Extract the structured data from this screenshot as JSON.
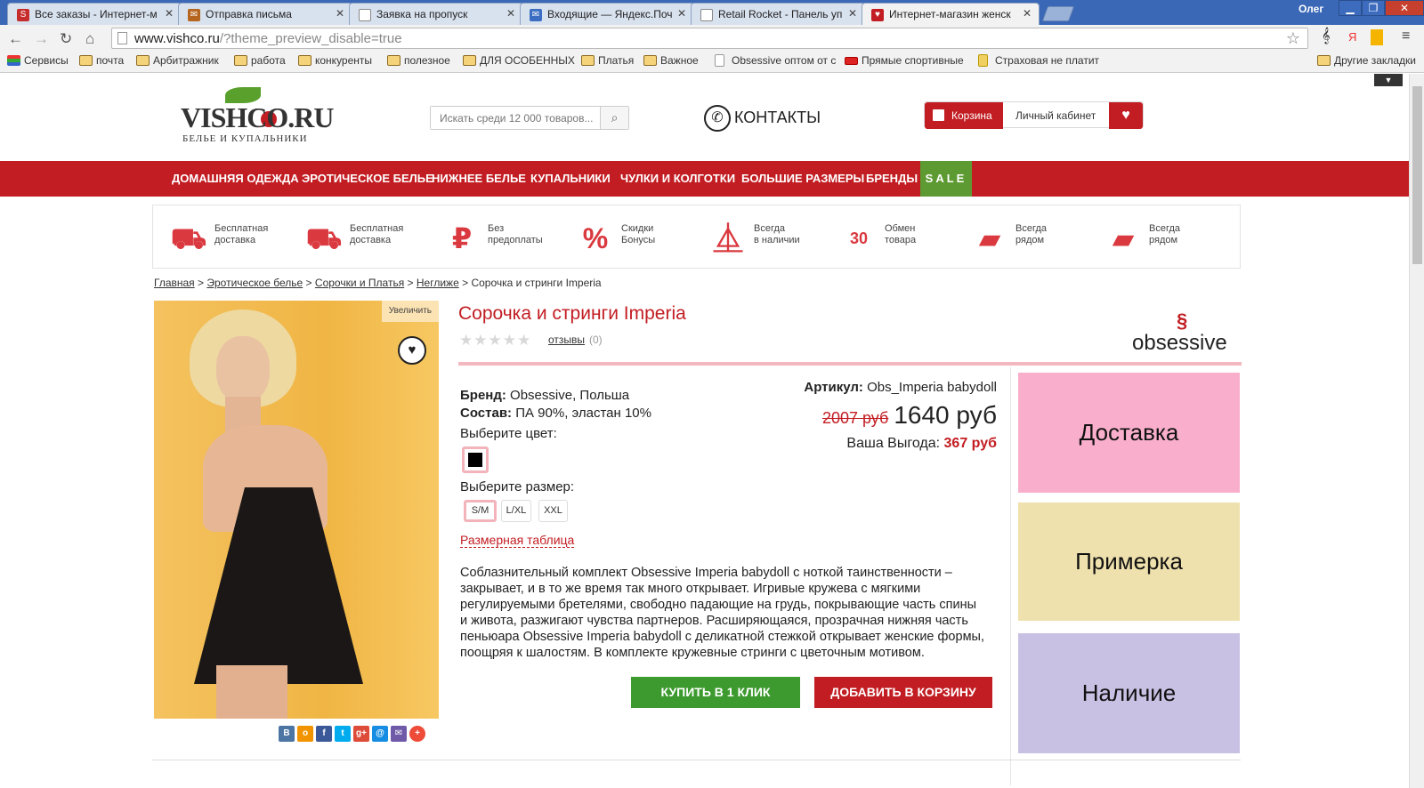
{
  "browser": {
    "tabs": [
      {
        "title": "Все заказы - Интернет-м",
        "fav_color": "#c72c2c",
        "fav_glyph": "S"
      },
      {
        "title": "Отправка письма",
        "fav_color": "#b5651d",
        "fav_glyph": "✉"
      },
      {
        "title": "Заявка на пропуск",
        "fav_color": "#ffffff",
        "fav_glyph": ""
      },
      {
        "title": "Входящие — Яндекс.Поч",
        "fav_color": "#3b6ec2",
        "fav_glyph": "✉"
      },
      {
        "title": "Retail Rocket - Панель уп",
        "fav_color": "#ffffff",
        "fav_glyph": ""
      },
      {
        "title": "Интернет-магазин женск",
        "fav_color": "#c21d22",
        "fav_glyph": "♥"
      }
    ],
    "user": "Олег",
    "url_host": "www.vishco.ru",
    "url_path": "/?theme_preview_disable=true",
    "bookmarks": [
      {
        "label": "Сервисы",
        "icon": "apps-icon"
      },
      {
        "label": "почта",
        "icon": "folder-icon"
      },
      {
        "label": "Арбитражник",
        "icon": "folder-icon"
      },
      {
        "label": "работа",
        "icon": "folder-icon"
      },
      {
        "label": "конкуренты",
        "icon": "folder-icon"
      },
      {
        "label": "полезное",
        "icon": "folder-icon"
      },
      {
        "label": "ДЛЯ ОСОБЕННЫХ",
        "icon": "folder-icon"
      },
      {
        "label": "Платья",
        "icon": "folder-icon"
      },
      {
        "label": "Важное",
        "icon": "folder-icon"
      },
      {
        "label": "Obsessive оптом от с",
        "icon": "page-icon"
      },
      {
        "label": "Прямые спортивные",
        "icon": "live-icon"
      },
      {
        "label": "Страховая не платит",
        "icon": "page-icon"
      },
      {
        "label": "Другие закладки",
        "icon": "folder-icon"
      }
    ]
  },
  "site": {
    "logo_text": "VISHCO.RU",
    "logo_sub": "БЕЛЬЕ И КУПАЛЬНИКИ",
    "search_placeholder": "Искать среди 12 000 товаров...",
    "contacts": "КОНТАКТЫ",
    "cart": "Корзина",
    "account": "Личный кабинет",
    "menu": [
      "ДОМАШНЯЯ ОДЕЖДА",
      "ЭРОТИЧЕСКОЕ БЕЛЬЕ",
      "НИЖНЕЕ БЕЛЬЕ",
      "КУПАЛЬНИКИ",
      "ЧУЛКИ И КОЛГОТКИ",
      "БОЛЬШИЕ РАЗМЕРЫ",
      "БРЕНДЫ",
      "SALE"
    ],
    "advantages": [
      {
        "icon": "truck-icon",
        "text": "Бесплатная\nдоставка"
      },
      {
        "icon": "truck-icon",
        "text": "Бесплатная\nдоставка"
      },
      {
        "icon": "money-bag-icon",
        "text": "Без\nпредоплаты"
      },
      {
        "icon": "percent-icon",
        "text": "Скидки\nБонусы"
      },
      {
        "icon": "hanger-icon",
        "text": "Всегда\nв наличии"
      },
      {
        "icon": "exchange-30-icon",
        "text": "Обмен\nтовара"
      },
      {
        "icon": "russia-map-icon",
        "text": "Всегда\nрядом"
      },
      {
        "icon": "russia-map-icon",
        "text": "Всегда\nрядом"
      }
    ],
    "breadcrumbs": [
      "Главная",
      "Эротическое белье",
      "Сорочки и Платья",
      "Неглиже"
    ],
    "breadcrumb_current": "Сорочка и стринги Imperia"
  },
  "product": {
    "title": "Сорочка и стринги Imperia",
    "reviews_label": "отзывы",
    "reviews_count": "(0)",
    "rating": 0,
    "zoom_label": "Увеличить",
    "brand_logo": "obsessive",
    "brand_label": "Бренд:",
    "brand_value": "Obsessive, Польша",
    "composition_label": "Состав:",
    "composition_value": "ПА 90%, эластан 10%",
    "article_label": "Артикул:",
    "article_value": "Obs_Imperia babydoll",
    "old_price": "2007 руб",
    "price": "1640 руб",
    "savings_label": "Ваша Выгода:",
    "savings_value": "367 руб",
    "choose_color": "Выберите цвет:",
    "color_swatch": "#000000",
    "choose_size": "Выберите размер:",
    "sizes": [
      "S/M",
      "L/XL",
      "XXL"
    ],
    "selected_size": "S/M",
    "size_table": "Размерная таблица",
    "description": "Соблазнительный комплект Obsessive Imperia babydoll с ноткой таинственности – закрывает, и в то же время так много открывает. Игривые кружева с мягкими регулируемыми бретелями, свободно падающие на грудь, покрывающие часть спины и живота, разжигают чувства партнеров. Расширяющаяся, прозрачная нижняя часть пеньюара Obsessive Imperia babydoll с деликатной стежкой открывает женские формы, поощряя к шалостям. В комплекте кружевные стринги с цветочным мотивом.",
    "buy_one_click": "КУПИТЬ В 1 КЛИК",
    "add_to_cart": "ДОБАВИТЬ В КОРЗИНУ",
    "share_icons": [
      "vk-icon",
      "odnoklassniki-icon",
      "facebook-icon",
      "twitter-icon",
      "google-plus-icon",
      "mailru-icon",
      "email-icon",
      "more-icon"
    ]
  },
  "info_boxes": [
    {
      "label": "Доставка",
      "color": "#f9afcb"
    },
    {
      "label": "Примерка",
      "color": "#efe1ad"
    },
    {
      "label": "Наличие",
      "color": "#c9c1e4"
    }
  ],
  "colors": {
    "brand_red": "#c21d22",
    "sale_green": "#5e9a32",
    "buy_green": "#3d9a2e",
    "chrome_blue": "#3a68b6"
  }
}
